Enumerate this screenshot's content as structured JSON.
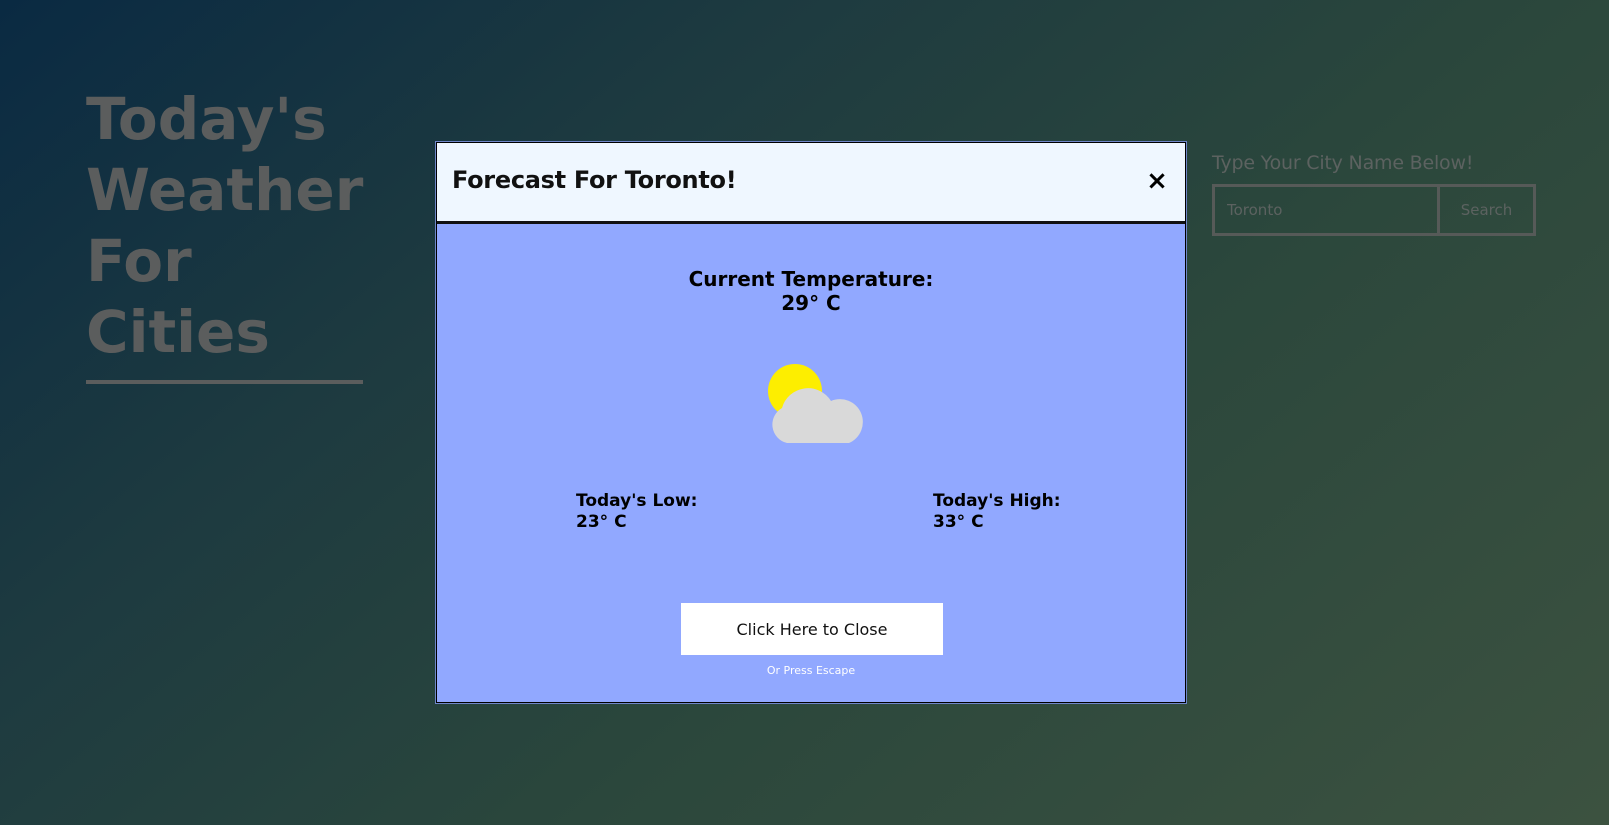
{
  "page": {
    "title": "Today's Weather For Cities"
  },
  "search": {
    "label": "Type Your City Name Below!",
    "value": "Toronto",
    "button_label": "Search"
  },
  "modal": {
    "title": "Forecast For Toronto!",
    "close_icon": "×",
    "current_label": "Current Temperature:",
    "current_value": "29° C",
    "weather_icon": "partly-cloudy-icon",
    "low_label": "Today's Low:",
    "low_value": "23° C",
    "high_label": "Today's High:",
    "high_value": "33° C",
    "close_button_label": "Click Here to Close",
    "escape_hint": "Or Press Escape"
  },
  "colors": {
    "modal_body": "#91a8ff",
    "modal_header": "#eff7ff",
    "sun": "#fdee00",
    "cloud": "#d9d9d9"
  }
}
